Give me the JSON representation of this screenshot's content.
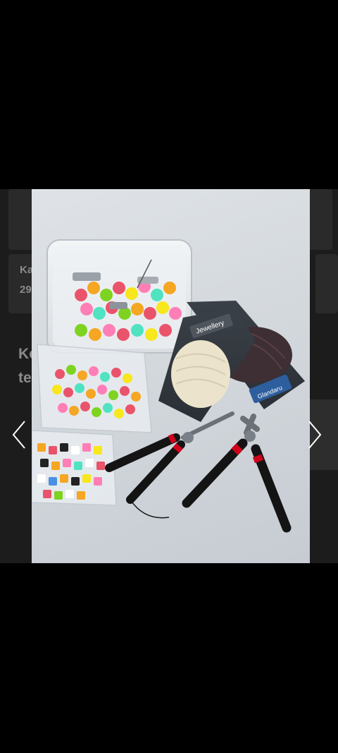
{
  "background_page": {
    "card1_line1": "Ka",
    "card1_line2": "29",
    "card2_line1": "Ko",
    "card2_line2": "te"
  },
  "photo": {
    "jewellery_card_label": "Jewellery",
    "blue_card_label": "Glandaru"
  },
  "navigation": {
    "prev_icon": "chevron-left-icon",
    "next_icon": "chevron-right-icon"
  }
}
